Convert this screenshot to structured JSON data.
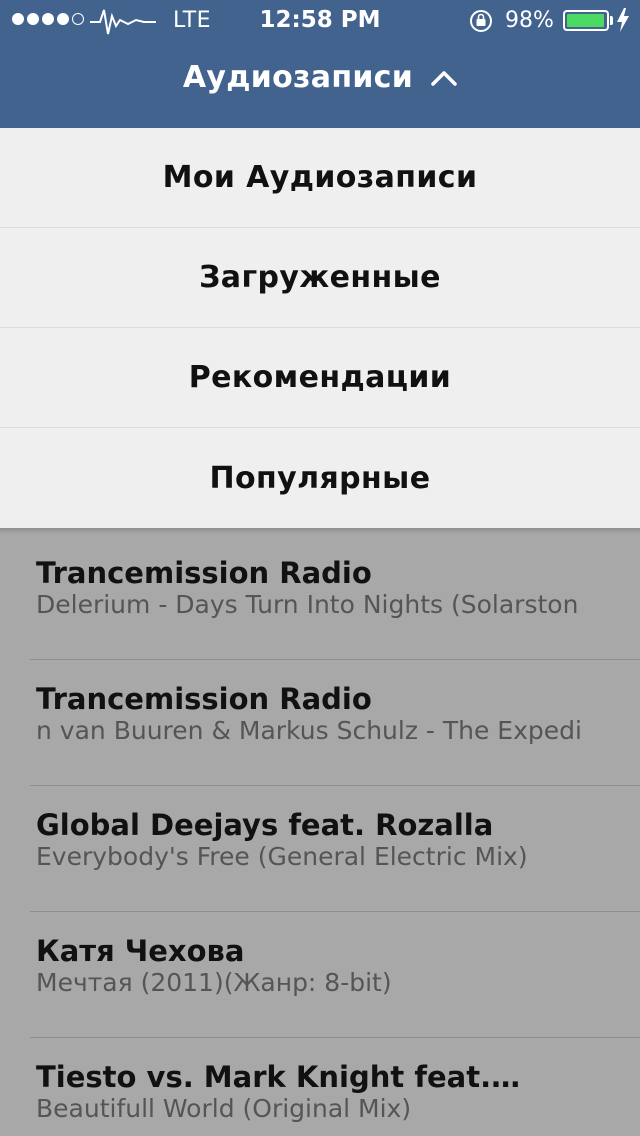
{
  "status_bar": {
    "carrier": "LTE",
    "time": "12:58 PM",
    "battery_percent_label": "98%",
    "battery_level": 0.98,
    "icons": [
      "signal-dots-icon",
      "pulse-icon",
      "rotation-lock-icon",
      "battery-icon",
      "charging-bolt-icon"
    ]
  },
  "nav": {
    "title": "Аудиозаписи",
    "toggle_icon": "chevron-up-icon"
  },
  "menu": {
    "items": [
      {
        "label": "Мои Аудиозаписи"
      },
      {
        "label": "Загруженные"
      },
      {
        "label": "Рекомендации"
      },
      {
        "label": "Популярные"
      }
    ]
  },
  "tracks": [
    {
      "artist": "Trancemission Radio",
      "title": "Delerium - Days Turn Into Nights (Solarston"
    },
    {
      "artist": "Trancemission Radio",
      "title": "n van Buuren & Markus Schulz - The Expedi"
    },
    {
      "artist": "Global Deejays feat. Rozalla",
      "title": "Everybody's Free (General Electric Mix)"
    },
    {
      "artist": "Катя Чехова",
      "title": "Мечтая (2011)(Жанр: 8-bit)"
    },
    {
      "artist": "Tiesto vs. Mark Knight feat.…",
      "title": "Beautifull World (Original Mix)"
    }
  ],
  "colors": {
    "nav_background": "#43638f",
    "menu_background": "#efefef",
    "dim_overlay": "#a8a8a8",
    "battery_fill": "#4cd964"
  }
}
